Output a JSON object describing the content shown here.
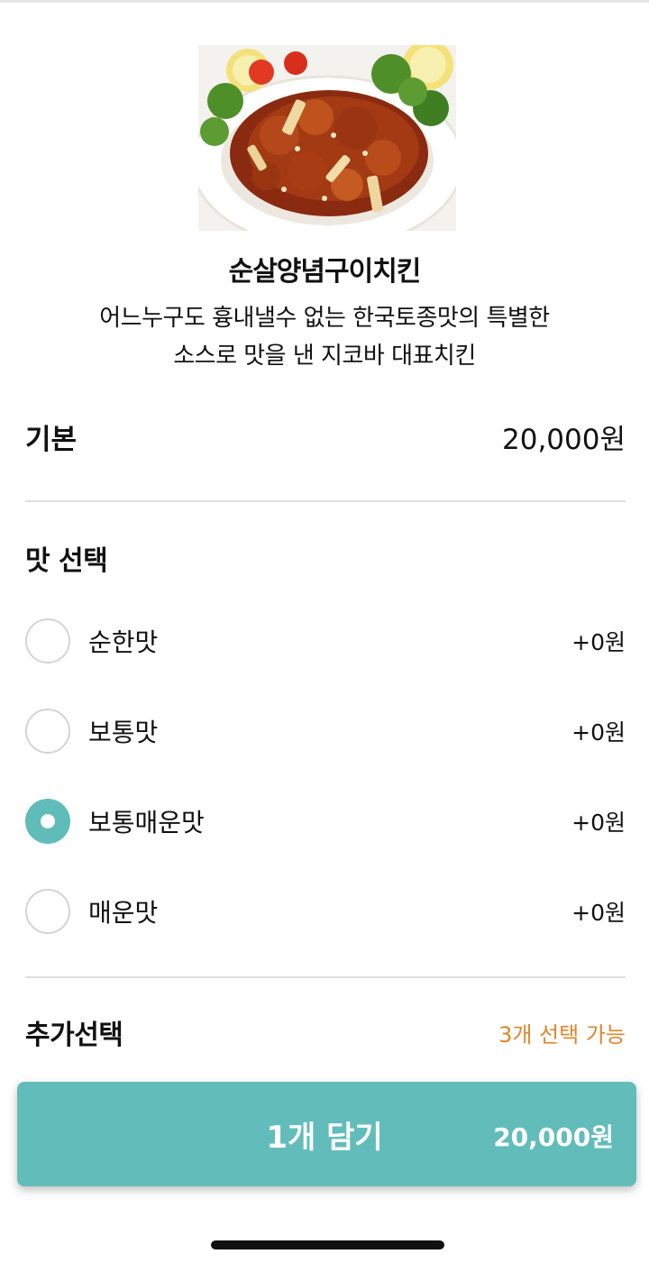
{
  "product": {
    "name": "순살양념구이치킨",
    "description_line1": "어느누구도 흉내낼수 없는 한국토종맛의 특별한",
    "description_line2": "소스로 맛을 낸 지코바 대표치킨"
  },
  "base": {
    "label": "기본",
    "price": "20,000원"
  },
  "flavor": {
    "title": "맛 선택",
    "options": [
      {
        "label": "순한맛",
        "price": "+0원",
        "selected": false
      },
      {
        "label": "보통맛",
        "price": "+0원",
        "selected": false
      },
      {
        "label": "보통매운맛",
        "price": "+0원",
        "selected": true
      },
      {
        "label": "매운맛",
        "price": "+0원",
        "selected": false
      }
    ]
  },
  "extra": {
    "title": "추가선택",
    "note": "3개 선택 가능"
  },
  "cart_button": {
    "label": "1개 담기",
    "price": "20,000원"
  },
  "colors": {
    "accent": "#62bdba",
    "selected_radio": "#5fbcb9",
    "note": "#e0872c"
  }
}
